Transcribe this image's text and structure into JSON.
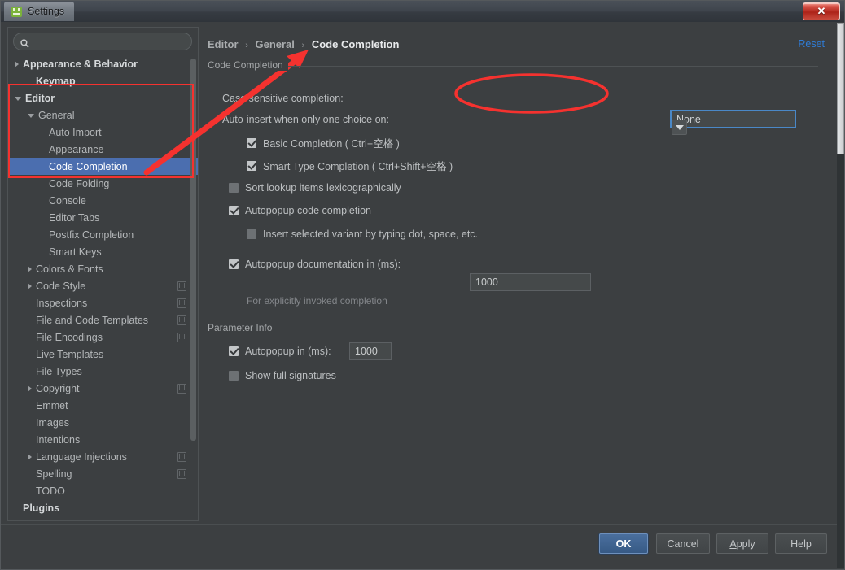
{
  "window": {
    "title": "Settings",
    "app_icon": "intellij-icon",
    "close_label": "✕",
    "ghost_text": ""
  },
  "sidebar": {
    "search": {
      "value": "",
      "placeholder": "",
      "icon": "search-icon"
    },
    "items": [
      {
        "label": "Appearance & Behavior",
        "indent": 0,
        "arrow": "right",
        "bold": true,
        "selected": false,
        "cfg": false
      },
      {
        "label": "Keymap",
        "indent": 1,
        "arrow": "none",
        "bold": true,
        "selected": false,
        "cfg": false
      },
      {
        "label": "Editor",
        "indent": 0,
        "arrow": "down",
        "bold": true,
        "selected": false,
        "cfg": false
      },
      {
        "label": "General",
        "indent": 1,
        "arrow": "down",
        "bold": false,
        "selected": false,
        "cfg": false
      },
      {
        "label": "Auto Import",
        "indent": 2,
        "arrow": "none",
        "bold": false,
        "selected": false,
        "cfg": false
      },
      {
        "label": "Appearance",
        "indent": 2,
        "arrow": "none",
        "bold": false,
        "selected": false,
        "cfg": false
      },
      {
        "label": "Code Completion",
        "indent": 2,
        "arrow": "none",
        "bold": false,
        "selected": true,
        "cfg": false
      },
      {
        "label": "Code Folding",
        "indent": 2,
        "arrow": "none",
        "bold": false,
        "selected": false,
        "cfg": false
      },
      {
        "label": "Console",
        "indent": 2,
        "arrow": "none",
        "bold": false,
        "selected": false,
        "cfg": false
      },
      {
        "label": "Editor Tabs",
        "indent": 2,
        "arrow": "none",
        "bold": false,
        "selected": false,
        "cfg": false
      },
      {
        "label": "Postfix Completion",
        "indent": 2,
        "arrow": "none",
        "bold": false,
        "selected": false,
        "cfg": false
      },
      {
        "label": "Smart Keys",
        "indent": 2,
        "arrow": "none",
        "bold": false,
        "selected": false,
        "cfg": false
      },
      {
        "label": "Colors & Fonts",
        "indent": 1,
        "arrow": "right",
        "bold": false,
        "selected": false,
        "cfg": false
      },
      {
        "label": "Code Style",
        "indent": 1,
        "arrow": "right",
        "bold": false,
        "selected": false,
        "cfg": true
      },
      {
        "label": "Inspections",
        "indent": 1,
        "arrow": "none",
        "bold": false,
        "selected": false,
        "cfg": true
      },
      {
        "label": "File and Code Templates",
        "indent": 1,
        "arrow": "none",
        "bold": false,
        "selected": false,
        "cfg": true
      },
      {
        "label": "File Encodings",
        "indent": 1,
        "arrow": "none",
        "bold": false,
        "selected": false,
        "cfg": true
      },
      {
        "label": "Live Templates",
        "indent": 1,
        "arrow": "none",
        "bold": false,
        "selected": false,
        "cfg": false
      },
      {
        "label": "File Types",
        "indent": 1,
        "arrow": "none",
        "bold": false,
        "selected": false,
        "cfg": false
      },
      {
        "label": "Copyright",
        "indent": 1,
        "arrow": "right",
        "bold": false,
        "selected": false,
        "cfg": true
      },
      {
        "label": "Emmet",
        "indent": 1,
        "arrow": "none",
        "bold": false,
        "selected": false,
        "cfg": false
      },
      {
        "label": "Images",
        "indent": 1,
        "arrow": "none",
        "bold": false,
        "selected": false,
        "cfg": false
      },
      {
        "label": "Intentions",
        "indent": 1,
        "arrow": "none",
        "bold": false,
        "selected": false,
        "cfg": false
      },
      {
        "label": "Language Injections",
        "indent": 1,
        "arrow": "right",
        "bold": false,
        "selected": false,
        "cfg": true
      },
      {
        "label": "Spelling",
        "indent": 1,
        "arrow": "none",
        "bold": false,
        "selected": false,
        "cfg": true
      },
      {
        "label": "TODO",
        "indent": 1,
        "arrow": "none",
        "bold": false,
        "selected": false,
        "cfg": false
      },
      {
        "label": "Plugins",
        "indent": 0,
        "arrow": "none",
        "bold": true,
        "selected": false,
        "cfg": false
      }
    ]
  },
  "main": {
    "breadcrumb": {
      "crumb1": "Editor",
      "crumb2": "General",
      "current": "Code Completion",
      "separator": "›"
    },
    "reset_label": "Reset",
    "groups": {
      "code_completion": {
        "title": "Code Completion",
        "case_sensitive_label": "Case sensitive completion:",
        "case_sensitive_value": "None",
        "auto_insert_label": "Auto-insert when only one choice on:",
        "basic_completion": {
          "label": "Basic Completion ( Ctrl+空格 )",
          "checked": true
        },
        "smart_type_completion": {
          "label": "Smart Type Completion ( Ctrl+Shift+空格 )",
          "checked": true
        },
        "sort_lookup": {
          "label": "Sort lookup items lexicographically",
          "checked": false
        },
        "autopopup_code": {
          "label": "Autopopup code completion",
          "checked": true
        },
        "insert_selected_variant": {
          "label": "Insert selected variant by typing dot, space, etc.",
          "checked": false
        },
        "autopopup_doc": {
          "label": "Autopopup documentation in (ms):",
          "checked": true,
          "value": "1000"
        },
        "autopopup_doc_hint": "For explicitly invoked completion"
      },
      "parameter_info": {
        "title": "Parameter Info",
        "autopopup_in": {
          "label": "Autopopup in (ms):",
          "checked": true,
          "value": "1000"
        },
        "show_full_signatures": {
          "label": "Show full signatures",
          "checked": false
        }
      }
    }
  },
  "footer": {
    "ok": "OK",
    "cancel": "Cancel",
    "apply_pre": "A",
    "apply_rest": "pply",
    "help": "Help"
  },
  "annotations": {
    "accent_color": "#f5322f",
    "highlight_rect": "sidebar-editor-section",
    "highlight_ellipse": "case-sensitive-dropdown",
    "arrow": "breadcrumb-to-code-completion"
  }
}
